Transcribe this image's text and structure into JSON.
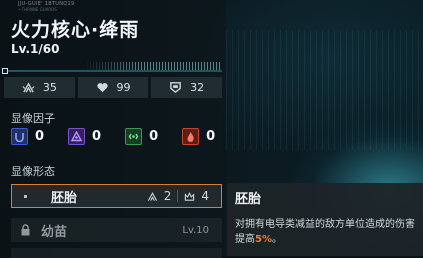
{
  "header": {
    "micro_text": "JJU-GUIE' 1BTUNQ19",
    "micro_subtext": "• THRNNE GUARDS",
    "title": "火力核心·绛雨",
    "level": "Lv.1/60"
  },
  "progress": {
    "value": 0.0
  },
  "stats": [
    {
      "icon": "attack-icon",
      "value": "35"
    },
    {
      "icon": "heart-icon",
      "value": "99"
    },
    {
      "icon": "shield-icon",
      "value": "32"
    }
  ],
  "factors_section": {
    "label": "显像因子",
    "items": [
      {
        "icon": "blue-factor-icon",
        "color": "#3a5bd6",
        "value": "0"
      },
      {
        "icon": "purple-factor-icon",
        "color": "#7a4fd0",
        "value": "0"
      },
      {
        "icon": "green-factor-icon",
        "color": "#3a9a52",
        "value": "0"
      },
      {
        "icon": "red-factor-icon",
        "color": "#c8432e",
        "value": "0"
      }
    ]
  },
  "forms_section": {
    "label": "显像形态",
    "forms": [
      {
        "name": "胚胎",
        "state": "active",
        "count_a": "2",
        "count_b": "4"
      },
      {
        "name": "幼苗",
        "state": "locked",
        "requirement": "Lv.10"
      },
      {
        "name": "",
        "state": "locked"
      }
    ]
  },
  "tooltip": {
    "title": "胚胎",
    "body_before": "对拥有电导类减益的敌方单位造成的伤害提高",
    "highlight": "5%",
    "body_after": "。"
  },
  "colors": {
    "accent": "#e07c2e",
    "highlight": "#f07a36"
  }
}
